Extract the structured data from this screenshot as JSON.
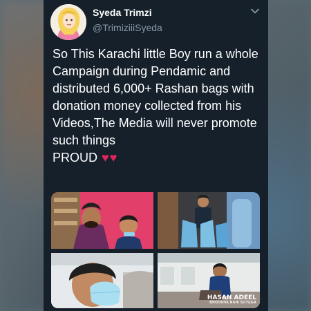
{
  "tweet": {
    "display_name": "Syeda Trimzi",
    "handle": "@TrimiziiiSyeda",
    "text": "So This Karachi little Boy run a whole Campaign during Pendamic and distributed 6,000+ Rashan bags with donation money collected from his Videos,The Media will never promote such things\nPROUD",
    "hearts": "♥♥",
    "heart_color": "#e0245e"
  },
  "media": {
    "watermark_title": "HASAN ADEEL",
    "watermark_subtitle": "BHOOKHA NAHI SOYEGA"
  },
  "icons": [
    "avatar-illustration",
    "chevron-down-icon",
    "heart-icon"
  ],
  "colors": {
    "tweet_background": "#15202b",
    "primary_text": "#ffffff",
    "secondary_text": "#8899a6"
  }
}
